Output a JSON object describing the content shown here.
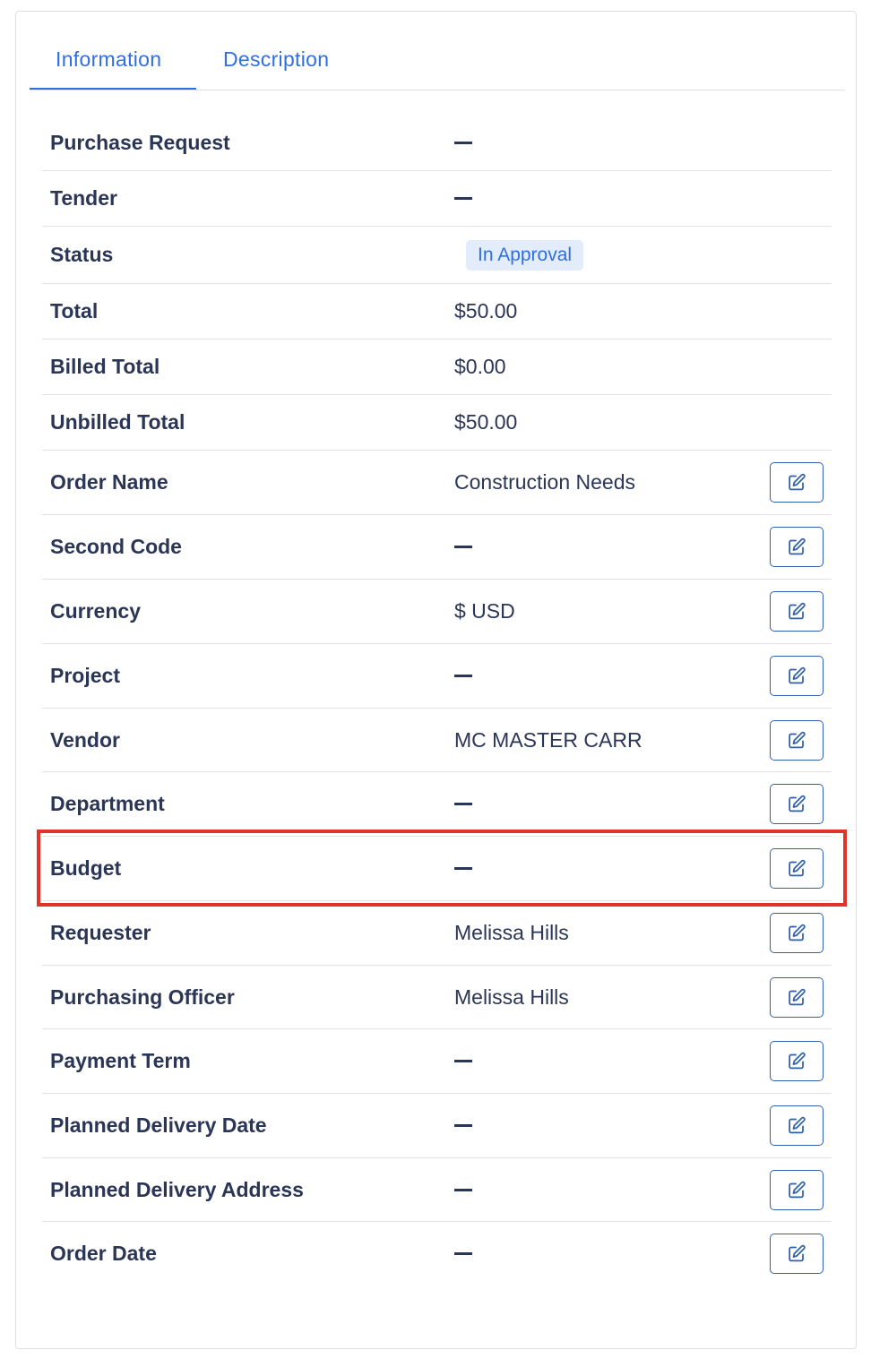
{
  "tabs": [
    {
      "label": "Information",
      "active": true
    },
    {
      "label": "Description",
      "active": false
    }
  ],
  "fields": [
    {
      "label": "Purchase Request",
      "value": "",
      "editable": false
    },
    {
      "label": "Tender",
      "value": "",
      "editable": false
    },
    {
      "label": "Status",
      "value": "In Approval",
      "badge": true,
      "editable": false
    },
    {
      "label": "Total",
      "value": "$50.00",
      "editable": false
    },
    {
      "label": "Billed Total",
      "value": "$0.00",
      "editable": false
    },
    {
      "label": "Unbilled Total",
      "value": "$50.00",
      "editable": false
    },
    {
      "label": "Order Name",
      "value": "Construction Needs",
      "editable": true
    },
    {
      "label": "Second Code",
      "value": "",
      "editable": true
    },
    {
      "label": "Currency",
      "value": "$ USD",
      "editable": true
    },
    {
      "label": "Project",
      "value": "",
      "editable": true
    },
    {
      "label": "Vendor",
      "value": "MC MASTER CARR",
      "editable": true
    },
    {
      "label": "Department",
      "value": "",
      "editable": true
    },
    {
      "label": "Budget",
      "value": "",
      "editable": true,
      "highlighted": true
    },
    {
      "label": "Requester",
      "value": "Melissa Hills",
      "editable": true
    },
    {
      "label": "Purchasing Officer",
      "value": "Melissa Hills",
      "editable": true
    },
    {
      "label": "Payment Term",
      "value": "",
      "editable": true
    },
    {
      "label": "Planned Delivery Date",
      "value": "",
      "editable": true
    },
    {
      "label": "Planned Delivery Address",
      "value": "",
      "editable": true
    },
    {
      "label": "Order Date",
      "value": "",
      "editable": true
    }
  ],
  "colors": {
    "accent": "#2f6fde",
    "text": "#2b3656",
    "badge_bg": "#e3ecfb",
    "highlight": "#e2332a"
  },
  "icons": {
    "edit": "edit-icon"
  }
}
